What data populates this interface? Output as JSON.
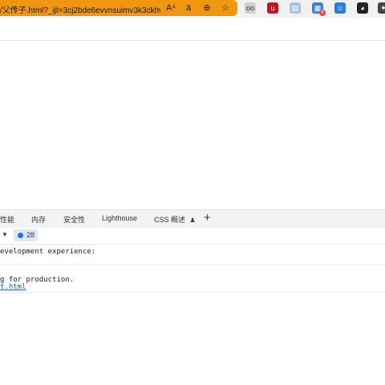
{
  "browser": {
    "url": "/父传子.html?_ijt=3cj2bde6evvnsuimv3k3ckhvu...",
    "url_icons": [
      "read-aloud-icon",
      "translate-icon",
      "zoom-icon",
      "favorite-icon"
    ],
    "url_icon_glyphs": [
      "A⁴",
      "á",
      "⊕",
      "☆"
    ],
    "extensions": [
      {
        "name": "owl-extension-icon",
        "color": "#7a7a7a",
        "glyph": "oo"
      },
      {
        "name": "ublock-extension-icon",
        "color": "#c0171b",
        "glyph": "u"
      },
      {
        "name": "folder-extension-icon",
        "color": "#6b8fd6",
        "glyph": "▤"
      },
      {
        "name": "grid-extension-icon",
        "color": "#3b7ddd",
        "glyph": "▦",
        "badge": "6"
      },
      {
        "name": "profile-extension-icon",
        "color": "#2a7be4",
        "glyph": "☺"
      },
      {
        "name": "face-extension-icon",
        "color": "#222222",
        "glyph": "◕"
      },
      {
        "name": "game-extension-icon",
        "color": "#444444",
        "glyph": "✦"
      }
    ]
  },
  "devtools": {
    "tabs": [
      "性能",
      "内存",
      "安全性",
      "Lighthouse",
      "CSS 概述"
    ],
    "add_tab": "+",
    "issues_count": "28",
    "console": {
      "line1": "evelopment experience:",
      "line2": "g for production.",
      "line3_link": "t.html"
    }
  }
}
